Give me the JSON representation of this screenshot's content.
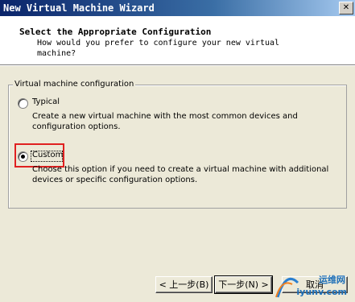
{
  "window": {
    "title": "New Virtual Machine Wizard",
    "close_glyph": "✕"
  },
  "header": {
    "title": "Select the Appropriate Configuration",
    "subtitle": "How would you prefer to configure your new virtual machine?"
  },
  "group": {
    "legend": "Virtual machine configuration",
    "options": [
      {
        "label": "Typical",
        "mnemonic": "T",
        "selected": false,
        "description": "Create a new virtual machine with the most common devices and configuration options."
      },
      {
        "label": "Custom",
        "mnemonic": "C",
        "selected": true,
        "description": "Choose this option if you need to create a virtual machine with additional devices or specific configuration options."
      }
    ]
  },
  "buttons": {
    "back": "< 上一步(B)",
    "next": "下一步(N) >",
    "cancel": "取消"
  },
  "watermark": {
    "text_cn": "运维网",
    "text_url": "iyunv.com"
  },
  "colors": {
    "highlight": "#e02020",
    "titlebar_start": "#0a246a",
    "titlebar_end": "#a6caf0"
  }
}
